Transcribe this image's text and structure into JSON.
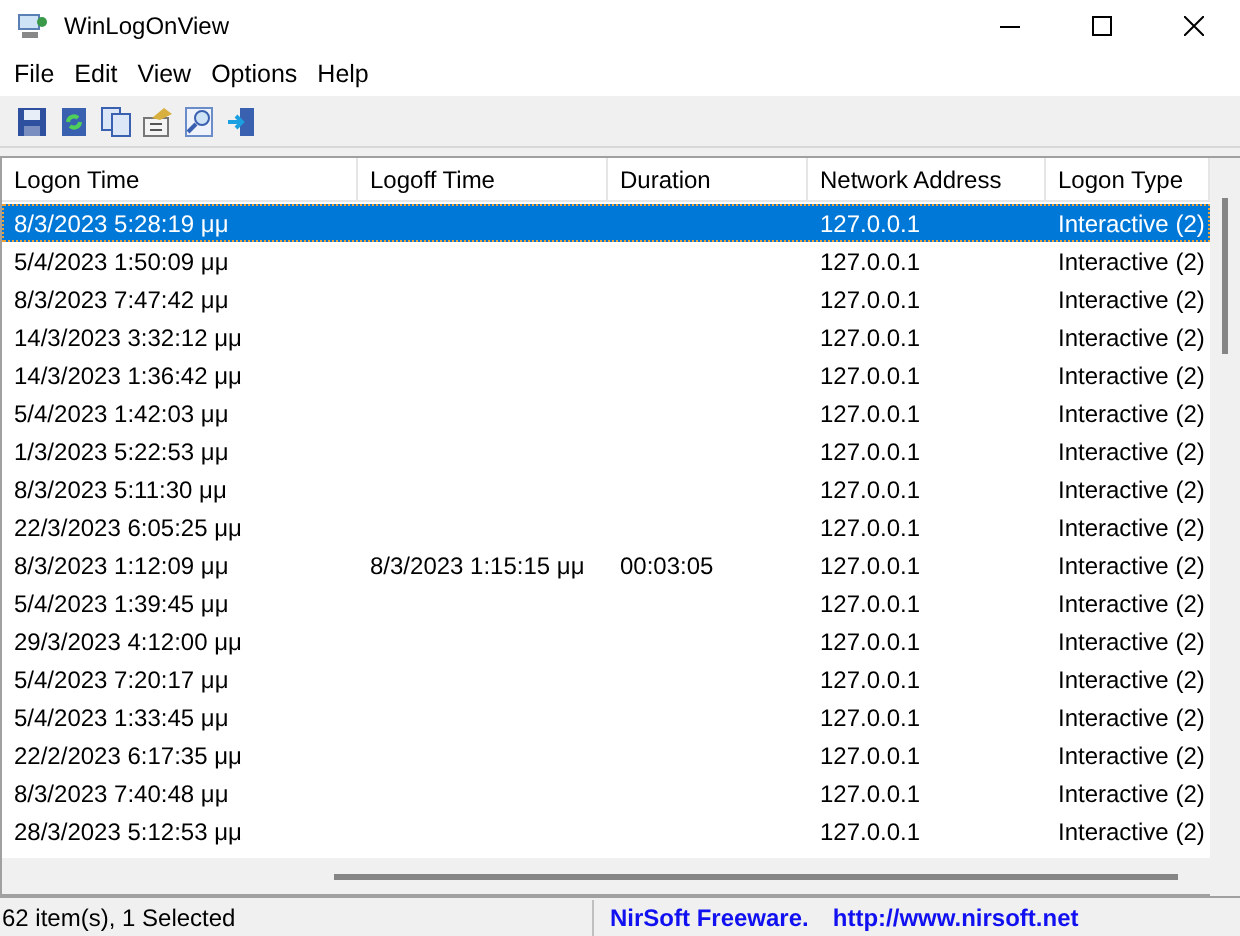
{
  "window": {
    "title": "WinLogOnView"
  },
  "menu": [
    "File",
    "Edit",
    "View",
    "Options",
    "Help"
  ],
  "table": {
    "columns": [
      "Logon Time",
      "Logoff Time",
      "Duration",
      "Network Address",
      "Logon Type"
    ],
    "rows": [
      {
        "logon_time": "8/3/2023 5:28:19 μμ",
        "network_address": "127.0.0.1",
        "logon_type": "Interactive (2)",
        "selected": true
      },
      {
        "logon_time": "5/4/2023 1:50:09 μμ",
        "network_address": "127.0.0.1",
        "logon_type": "Interactive (2)",
        "selected": false
      },
      {
        "logon_time": "8/3/2023 7:47:42 μμ",
        "network_address": "127.0.0.1",
        "logon_type": "Interactive (2)",
        "selected": false
      },
      {
        "logon_time": "14/3/2023 3:32:12 μμ",
        "network_address": "127.0.0.1",
        "logon_type": "Interactive (2)",
        "selected": false
      },
      {
        "logon_time": "14/3/2023 1:36:42 μμ",
        "network_address": "127.0.0.1",
        "logon_type": "Interactive (2)",
        "selected": false
      },
      {
        "logon_time": "5/4/2023 1:42:03 μμ",
        "network_address": "127.0.0.1",
        "logon_type": "Interactive (2)",
        "selected": false
      },
      {
        "logon_time": "1/3/2023 5:22:53 μμ",
        "network_address": "127.0.0.1",
        "logon_type": "Interactive (2)",
        "selected": false
      },
      {
        "logon_time": "8/3/2023 5:11:30 μμ",
        "network_address": "127.0.0.1",
        "logon_type": "Interactive (2)",
        "selected": false
      },
      {
        "logon_time": "22/3/2023 6:05:25 μμ",
        "network_address": "127.0.0.1",
        "logon_type": "Interactive (2)",
        "selected": false
      },
      {
        "logon_time": "8/3/2023 1:12:09 μμ",
        "logoff_time": "8/3/2023 1:15:15 μμ",
        "duration": "00:03:05",
        "network_address": "127.0.0.1",
        "logon_type": "Interactive (2)",
        "selected": false
      },
      {
        "logon_time": "5/4/2023 1:39:45 μμ",
        "network_address": "127.0.0.1",
        "logon_type": "Interactive (2)",
        "selected": false
      },
      {
        "logon_time": "29/3/2023 4:12:00 μμ",
        "network_address": "127.0.0.1",
        "logon_type": "Interactive (2)",
        "selected": false
      },
      {
        "logon_time": "5/4/2023 7:20:17 μμ",
        "network_address": "127.0.0.1",
        "logon_type": "Interactive (2)",
        "selected": false
      },
      {
        "logon_time": "5/4/2023 1:33:45 μμ",
        "network_address": "127.0.0.1",
        "logon_type": "Interactive (2)",
        "selected": false
      },
      {
        "logon_time": "22/2/2023 6:17:35 μμ",
        "network_address": "127.0.0.1",
        "logon_type": "Interactive (2)",
        "selected": false
      },
      {
        "logon_time": "8/3/2023 7:40:48 μμ",
        "network_address": "127.0.0.1",
        "logon_type": "Interactive (2)",
        "selected": false
      },
      {
        "logon_time": "28/3/2023 5:12:53 μμ",
        "network_address": "127.0.0.1",
        "logon_type": "Interactive (2)",
        "selected": false
      }
    ]
  },
  "status_bar": {
    "items": "62 item(s), 1 Selected",
    "credit": "NirSoft Freeware.",
    "link": "http://www.nirsoft.net"
  }
}
